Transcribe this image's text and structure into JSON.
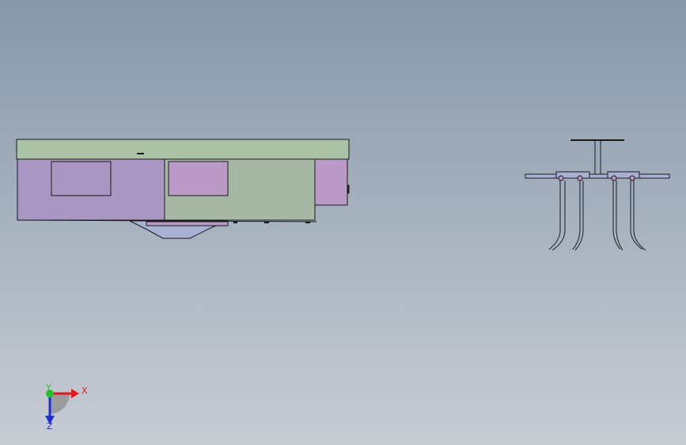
{
  "viewport": {
    "background_top": "#8798ab",
    "background_bottom": "#c7ccd3"
  },
  "triad": {
    "x_label": "X",
    "y_label": "Y",
    "z_label": "Z",
    "x_color": "#e8141a",
    "y_color": "#22c32b",
    "z_color": "#1a2fd6"
  },
  "model": {
    "outline_color": "#1a1a1a",
    "panel_green": "#a9c3a4",
    "panel_purple": "#a896c3",
    "panel_pink": "#bc9ac7",
    "panel_sage": "#a6b8a3",
    "panel_blue": "#a7b1d2"
  }
}
